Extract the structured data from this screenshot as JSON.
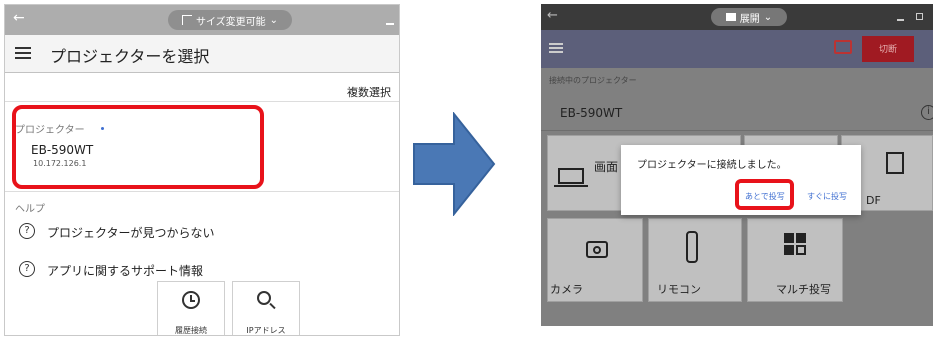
{
  "left": {
    "window_pill_label": "サイズ変更可能",
    "title": "プロジェクターを選択",
    "multi_select": "複数選択",
    "projector_header": "プロジェクター",
    "projector_name": "EB-590WT",
    "projector_ip": "10.172.126.1",
    "help_header": "ヘルプ",
    "help_items": [
      "プロジェクターが見つからない",
      "アプリに関するサポート情報"
    ],
    "bottom_buttons": [
      {
        "label": "履歴接続"
      },
      {
        "label": "IPアドレス"
      }
    ]
  },
  "right": {
    "window_pill_label": "展開",
    "disconnect_label": "切断",
    "connected_header": "接続中のプロジェクター",
    "projector_name": "EB-590WT",
    "tile_screen_label": "画面",
    "tile_pdf_label": "DF",
    "tiles": [
      {
        "label": "カメラ"
      },
      {
        "label": "リモコン"
      },
      {
        "label": "マルチ投写"
      }
    ],
    "dialog": {
      "message": "プロジェクターに接続しました。",
      "later_button": "あとで投写",
      "now_button": "すぐに投写"
    }
  },
  "colors": {
    "highlight_red": "#e8121a",
    "arrow_blue": "#4a78b5",
    "dialog_link_blue": "#3f6fd1"
  }
}
